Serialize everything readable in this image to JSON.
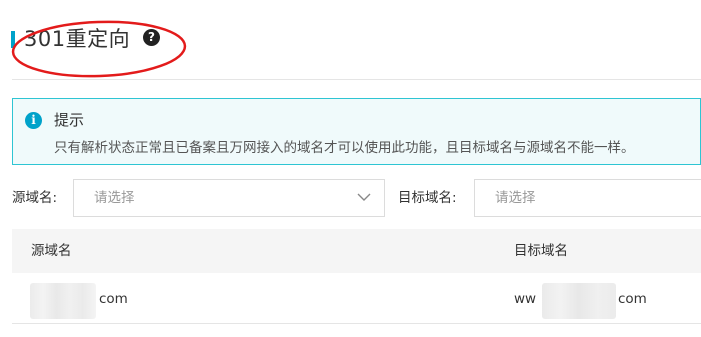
{
  "header": {
    "title": "301重定向",
    "help_icon": "?"
  },
  "tip": {
    "icon": "i",
    "title": "提示",
    "text": "只有解析状态正常且已备案且万网接入的域名才可以使用此功能，且目标域名与源域名不能一样。"
  },
  "filters": {
    "source_label": "源域名:",
    "source_placeholder": "请选择",
    "target_label": "目标域名:",
    "target_placeholder": "请选择"
  },
  "table": {
    "columns": [
      "源域名",
      "目标域名"
    ],
    "rows": [
      {
        "source_visible": "com",
        "target_prefix_visible": "ww",
        "target_suffix_visible": "com"
      }
    ]
  },
  "colors": {
    "accent": "#00a2ca",
    "tip_border": "#2ec5d3",
    "tip_background": "#f0fafb",
    "annotation": "#e31b1b"
  },
  "icons": {
    "help": "question-circle-icon",
    "tip": "info-circle-icon",
    "select": "chevron-down-icon"
  }
}
